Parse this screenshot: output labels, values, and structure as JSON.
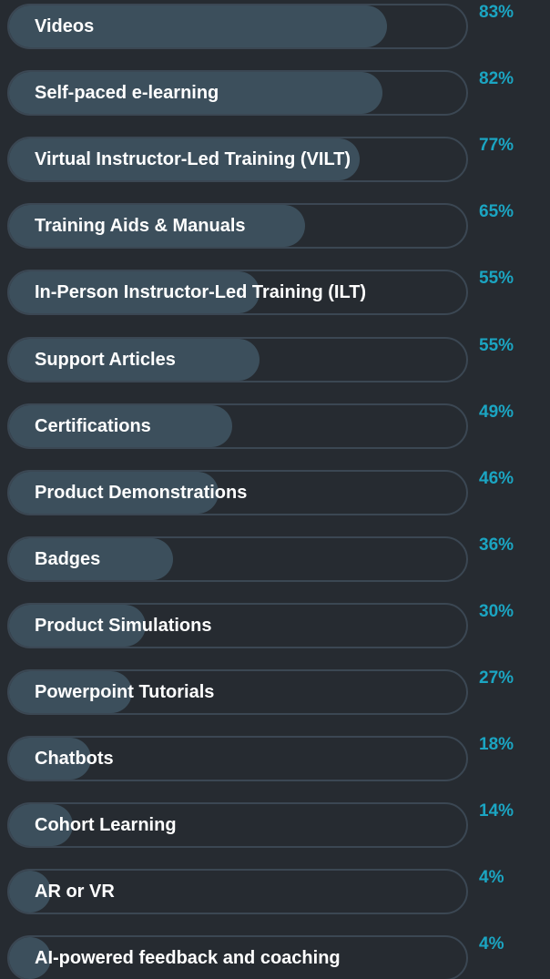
{
  "colors": {
    "background": "#262b31",
    "track_border": "#3b4753",
    "bar_fill": "#3c4f5c",
    "label_text": "#ffffff",
    "percent_text": "#1ba5c2"
  },
  "chart_data": {
    "type": "bar",
    "orientation": "horizontal",
    "title": "",
    "xlabel": "",
    "ylabel": "",
    "xlim": [
      0,
      100
    ],
    "grid": false,
    "categories": [
      "Videos",
      "Self-paced e-learning",
      "Virtual Instructor-Led Training (VILT)",
      "Training Aids & Manuals",
      "In-Person Instructor-Led Training (ILT)",
      "Support Articles",
      "Certifications",
      "Product Demonstrations",
      "Badges",
      "Product Simulations",
      "Powerpoint Tutorials",
      "Chatbots",
      "Cohort Learning",
      "AR or VR",
      "AI-powered feedback and coaching"
    ],
    "values": [
      83,
      82,
      77,
      65,
      55,
      55,
      49,
      46,
      36,
      30,
      27,
      18,
      14,
      4,
      4
    ],
    "value_labels": [
      "83%",
      "82%",
      "77%",
      "65%",
      "55%",
      "55%",
      "49%",
      "46%",
      "36%",
      "30%",
      "27%",
      "18%",
      "14%",
      "4%",
      "4%"
    ]
  }
}
